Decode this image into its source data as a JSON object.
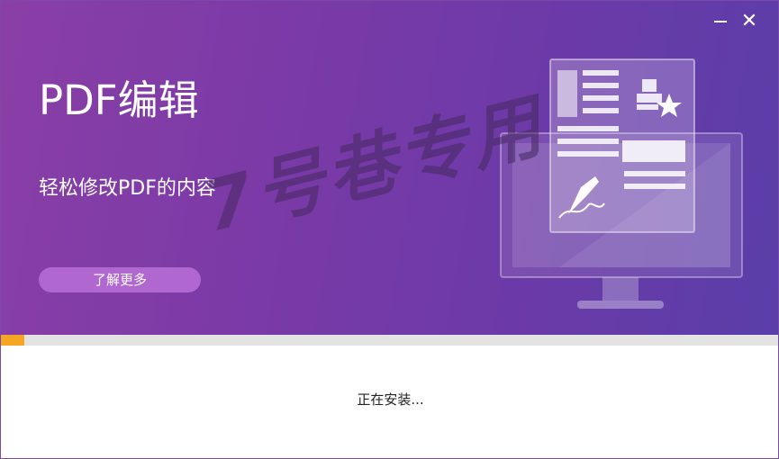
{
  "window": {
    "minimize_icon": "minimize-icon",
    "close_icon": "close-icon",
    "close_glyph": "✕"
  },
  "banner": {
    "title": "PDF编辑",
    "subtitle": "轻松修改PDF的内容",
    "learn_more_label": "了解更多",
    "watermark": "7号巷专用",
    "illustration": "pdf-edit-monitor-illustration"
  },
  "install": {
    "progress": 0.03,
    "status_text": "正在安装..."
  },
  "colors": {
    "banner_start": "#8a3fa6",
    "banner_end": "#5a3ea9",
    "progress_fill": "#f5a623",
    "progress_track": "#e3e3e3",
    "button_bg": "#b067cf"
  }
}
